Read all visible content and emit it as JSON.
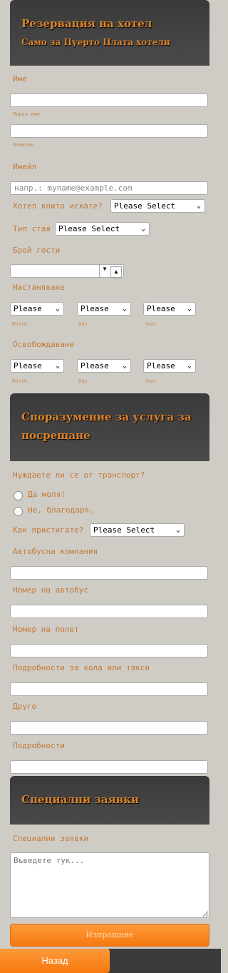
{
  "hotel_section": {
    "title": "Резервация на хотел",
    "subtitle": "Само за Пуерто Плата хотели",
    "name_label": "Име",
    "first_name_sub": "Първо име",
    "last_name_sub": "Фамилия",
    "email_label": "Имейл",
    "email_placeholder": "напр.: myname@example.com",
    "hotel_label": "Хотел които искате?",
    "hotel_select": "Please Select",
    "room_label": "Тип стая",
    "room_select": "Please Select",
    "guests_label": "Брой гости",
    "checkin_label": "Настаняване",
    "checkout_label": "Освобождаване",
    "date_select": "Please",
    "month_sub": "Month",
    "day_sub": "Day",
    "year_sub": "Year"
  },
  "transfer_section": {
    "title": "Споразумение за услуга за посрещане",
    "transport_label": "Нуждаете ли се от транспорт?",
    "option_yes": "Да моля!",
    "option_no": "Не, благодаря.",
    "arrival_label": "Как пристигате?",
    "arrival_select": "Please Select",
    "bus_company_label": "Автобусна компания",
    "bus_number_label": "Номер на автобус",
    "flight_label": "Номер на полет",
    "car_label": "Подробности за кола или такси",
    "other_label": "Друго",
    "details_label": "Подробности"
  },
  "special_section": {
    "title": "Специални заявки",
    "requests_label": "Специални заявки",
    "requests_placeholder": "Въведете тук..."
  },
  "actions": {
    "submit_label": "Изпращане",
    "back_label": "Назад"
  },
  "colors": {
    "accent": "#f5780f",
    "label": "#c37a36",
    "header_bg": "#3a3a3a",
    "page_bg": "#cfccc6"
  }
}
